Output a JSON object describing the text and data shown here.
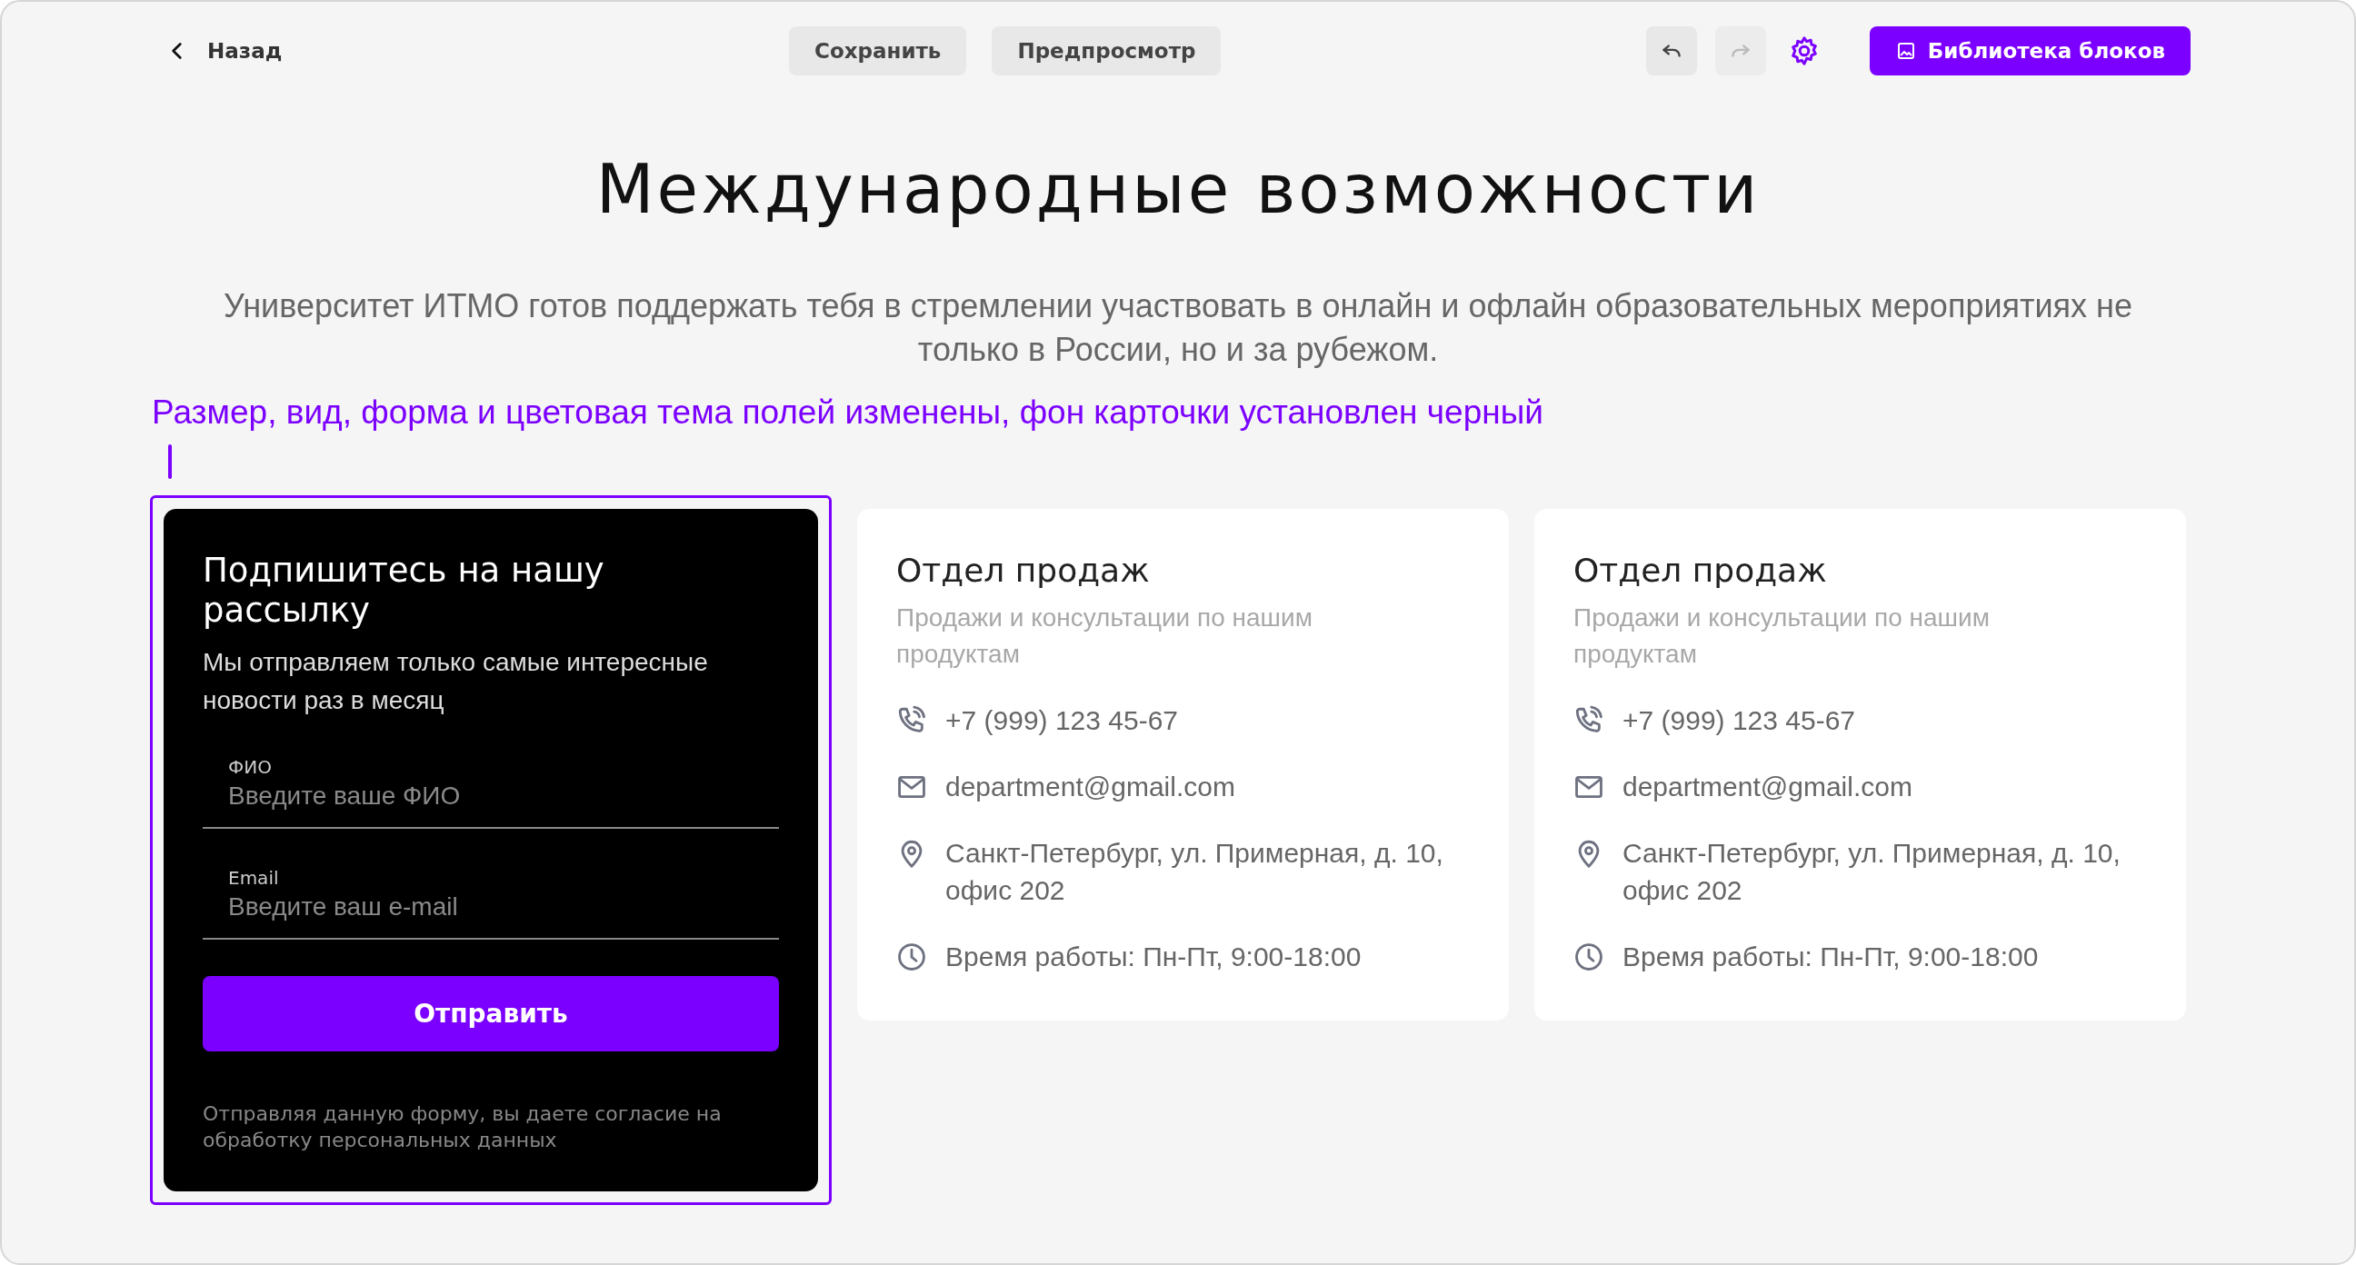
{
  "toolbar": {
    "back": {
      "label": "Назад"
    },
    "buttons": [
      {
        "label": "Сохранить"
      },
      {
        "label": "Предпросмотр"
      }
    ],
    "history": [
      {
        "kind": "undo",
        "disabled": false
      },
      {
        "kind": "redo",
        "disabled": true
      }
    ],
    "library": {
      "label": "Библиотека блоков"
    }
  },
  "heading": "Международные возможности",
  "description": "Университет ИТМО готов поддержать тебя в стремлении участвовать в онлайн и офлайн образовательных мероприятиях не только в России, но и за рубежом.",
  "annotation": "Размер, вид, форма и цветовая тема полей изменены, фон карточки установлен черный",
  "subscribe": {
    "selected": true,
    "title": "Подпишитесь на нашу рассылку",
    "text": "Мы отправляем только самые интересные новости раз в месяц",
    "fields": [
      {
        "label": "ФИО",
        "placeholder": "Введите ваше ФИО"
      },
      {
        "label": "Email",
        "placeholder": "Введите ваш e-mail"
      }
    ],
    "submit": "Отправить",
    "consent": "Отправляя данную форму, вы даете согласие на обработку персональных данных"
  },
  "contacts": [
    {
      "title": "Отдел продаж",
      "subtitle": "Продажи и консультации по нашим продуктам",
      "items": [
        {
          "kind": "phone",
          "text": "+7 (999) 123 45-67"
        },
        {
          "kind": "email",
          "text": "department@gmail.com"
        },
        {
          "kind": "address",
          "text": "Санкт-Петербург, ул. Примерная, д. 10, офис 202"
        },
        {
          "kind": "hours",
          "text": "Время работы: Пн-Пт, 9:00-18:00"
        }
      ]
    },
    {
      "title": "Отдел продаж",
      "subtitle": "Продажи и консультации по нашим продуктам",
      "items": [
        {
          "kind": "phone",
          "text": "+7 (999) 123 45-67"
        },
        {
          "kind": "email",
          "text": "department@gmail.com"
        },
        {
          "kind": "address",
          "text": "Санкт-Петербург, ул. Примерная, д. 10, офис 202"
        },
        {
          "kind": "hours",
          "text": "Время работы: Пн-Пт, 9:00-18:00"
        }
      ]
    }
  ]
}
